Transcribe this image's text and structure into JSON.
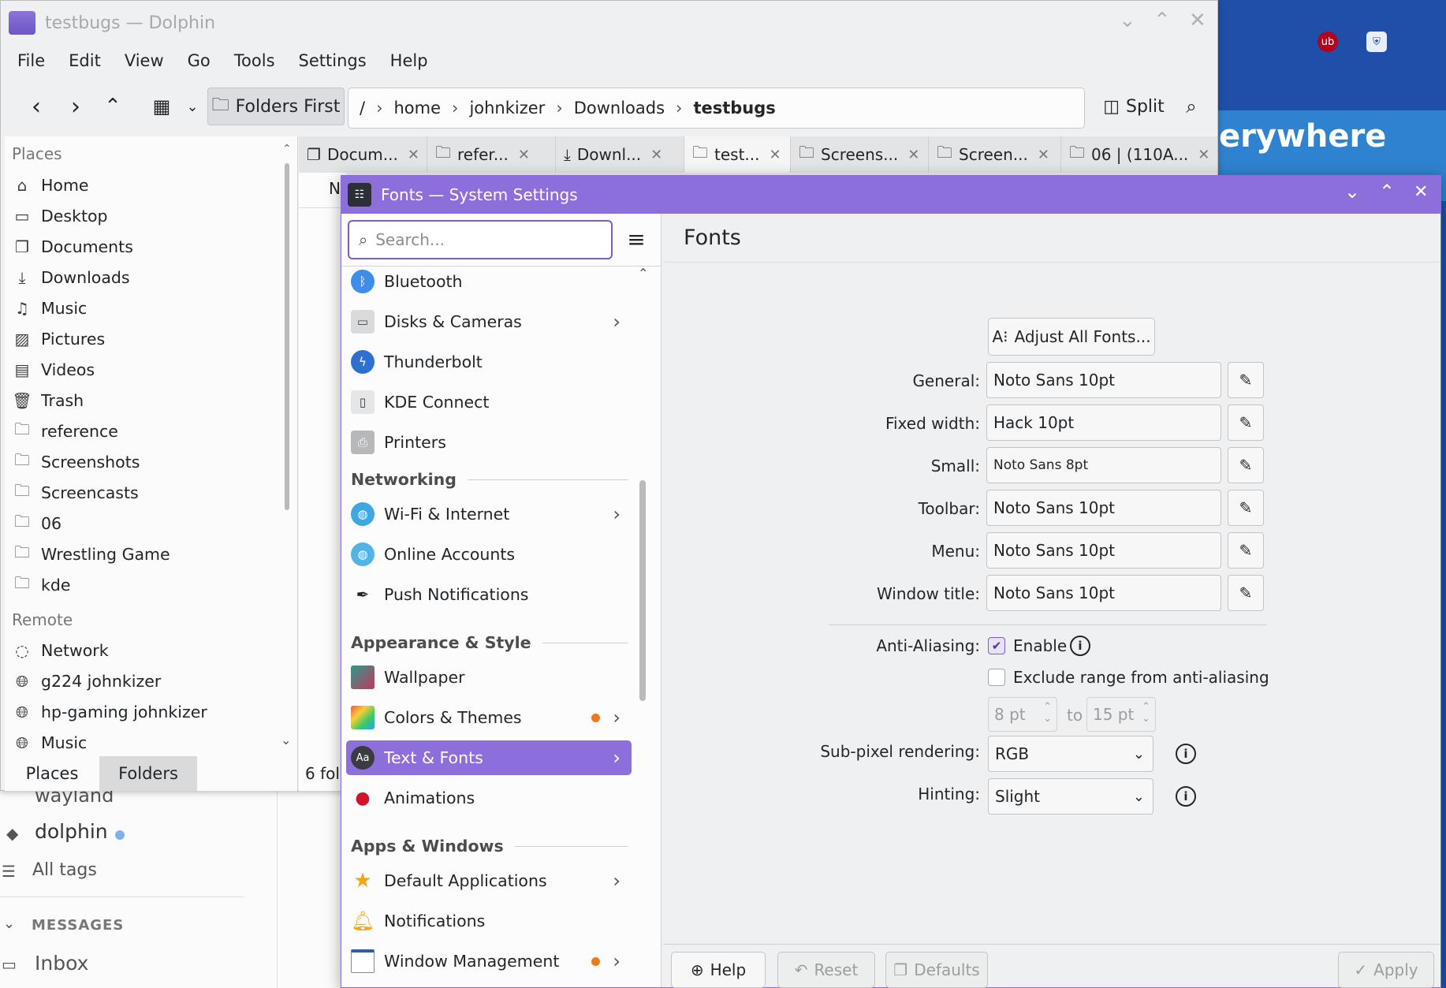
{
  "dolphin": {
    "title": "testbugs — Dolphin",
    "menu": [
      "File",
      "Edit",
      "View",
      "Go",
      "Tools",
      "Settings",
      "Help"
    ],
    "folders_first": "Folders First",
    "split": "Split",
    "breadcrumb": [
      "/",
      "home",
      "johnkizer",
      "Downloads",
      "testbugs"
    ],
    "places_header": "Places",
    "places": [
      "Home",
      "Desktop",
      "Documents",
      "Downloads",
      "Music",
      "Pictures",
      "Videos",
      "Trash",
      "reference",
      "Screenshots",
      "Screencasts",
      "06",
      "Wrestling Game",
      "kde"
    ],
    "remote_header": "Remote",
    "remote": [
      "Network",
      "g224 johnkizer",
      "hp-gaming johnkizer",
      "Music"
    ],
    "panel_tabs": [
      "Places",
      "Folders"
    ],
    "tabs": [
      "Docum...",
      "refer...",
      "Downl...",
      "test...",
      "Screens...",
      "Screen...",
      "06 | (110A..."
    ],
    "column_header_partial": "N",
    "status_partial": "6 fol"
  },
  "background": {
    "banner_text": "erywhere",
    "tag_wayland": "wayland",
    "tag_dolphin": "dolphin",
    "all_tags": "All tags",
    "messages": "MESSAGES",
    "inbox": "Inbox"
  },
  "settings": {
    "title": "Fonts — System Settings",
    "search_placeholder": "Search...",
    "page_title": "Fonts",
    "sidebar": {
      "bluetooth": "Bluetooth",
      "disks": "Disks & Cameras",
      "thunderbolt": "Thunderbolt",
      "kdeconnect": "KDE Connect",
      "printers": "Printers",
      "sec_networking": "Networking",
      "wifi": "Wi-Fi & Internet",
      "online": "Online Accounts",
      "push": "Push Notifications",
      "sec_appearance": "Appearance & Style",
      "wallpaper": "Wallpaper",
      "colors": "Colors & Themes",
      "textfonts": "Text & Fonts",
      "animations": "Animations",
      "sec_apps": "Apps & Windows",
      "defaultapps": "Default Applications",
      "notifications": "Notifications",
      "windowmgmt": "Window Management"
    },
    "adjust_all": "Adjust All Fonts...",
    "fonts": [
      {
        "label": "General:",
        "value": "Noto Sans 10pt"
      },
      {
        "label": "Fixed width:",
        "value": "Hack 10pt"
      },
      {
        "label": "Small:",
        "value": "Noto Sans 8pt"
      },
      {
        "label": "Toolbar:",
        "value": "Noto Sans 10pt"
      },
      {
        "label": "Menu:",
        "value": "Noto Sans 10pt"
      },
      {
        "label": "Window title:",
        "value": "Noto Sans 10pt"
      }
    ],
    "antialias_label": "Anti-Aliasing:",
    "enable": "Enable",
    "exclude": "Exclude range from anti-aliasing",
    "range_from": "8 pt",
    "range_to_label": "to",
    "range_to": "15 pt",
    "subpixel_label": "Sub-pixel rendering:",
    "subpixel_value": "RGB",
    "hinting_label": "Hinting:",
    "hinting_value": "Slight",
    "footer": {
      "help": "Help",
      "reset": "Reset",
      "defaults": "Defaults",
      "apply": "Apply"
    },
    "accent": "#8d6fdc"
  }
}
